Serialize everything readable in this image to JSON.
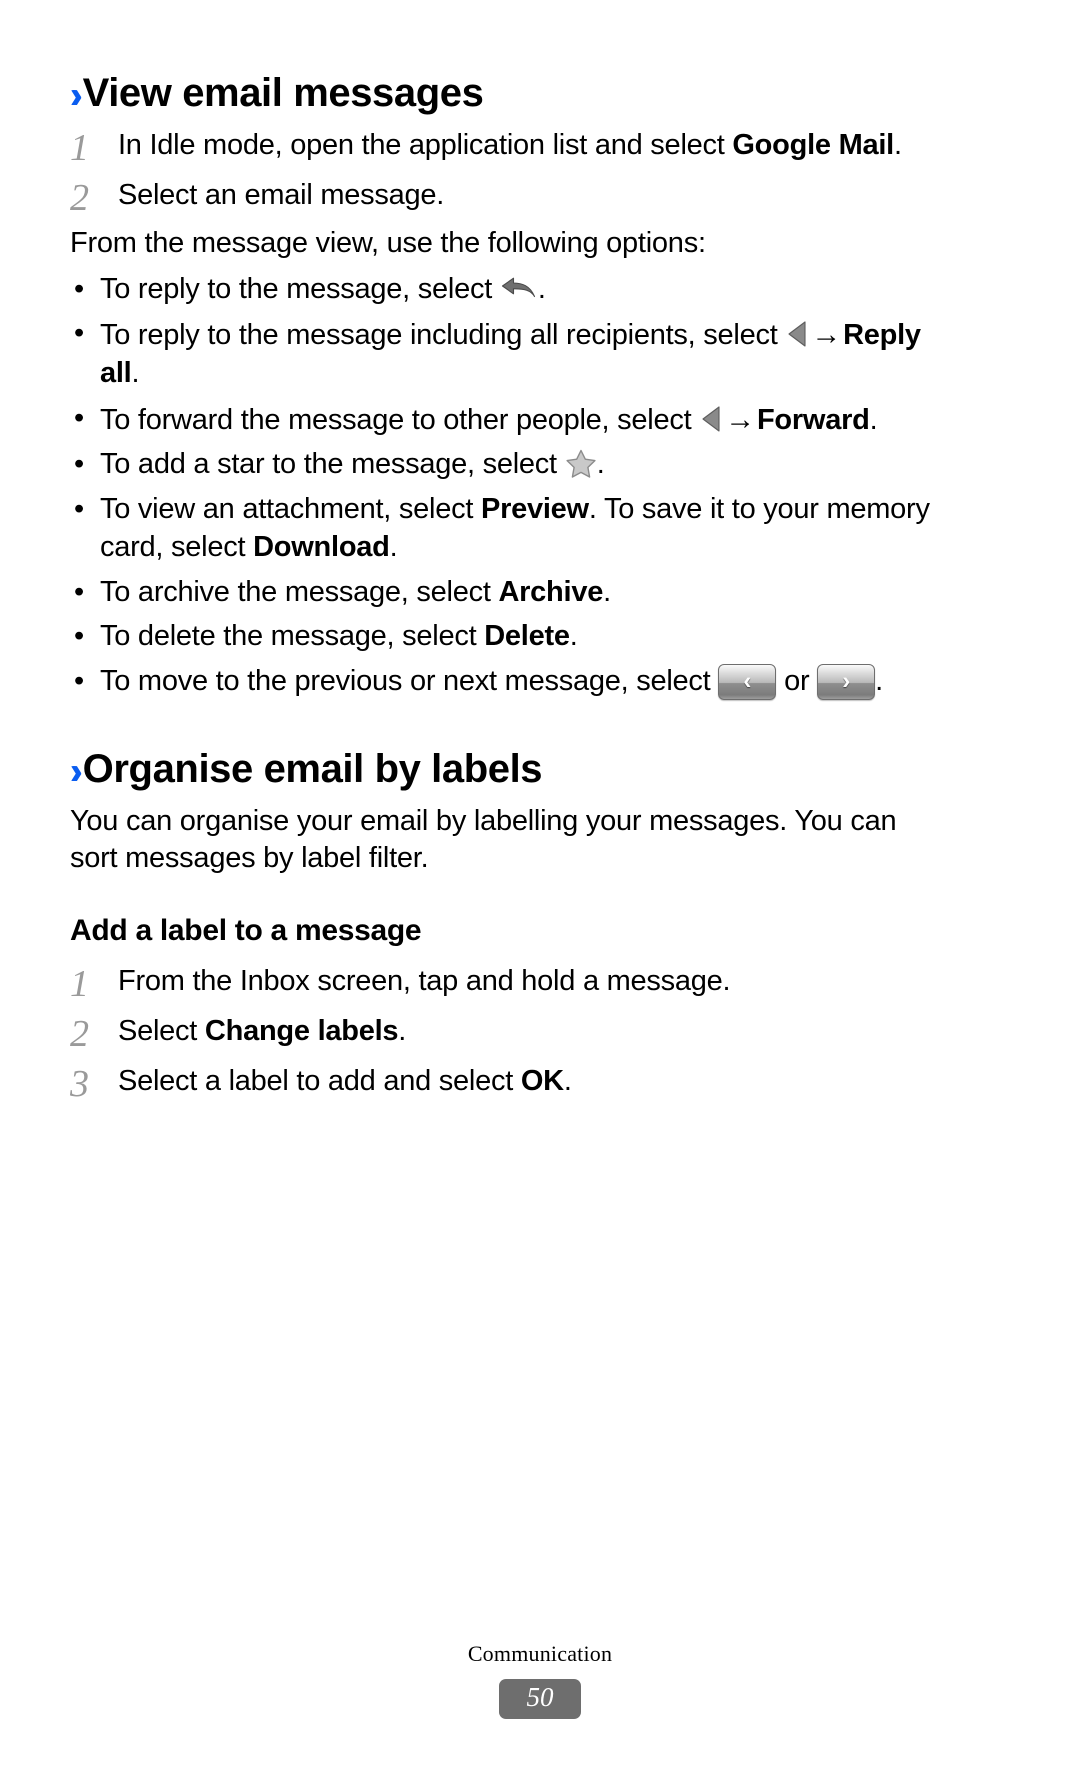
{
  "accent_color": "#0a5df0",
  "section1": {
    "heading": "View email messages",
    "chevron_icon": "double-chevron-right-icon",
    "steps": [
      {
        "num": "1",
        "text_before": "In Idle mode, open the application list and select ",
        "bold": "Google Mail",
        "text_after": "."
      },
      {
        "num": "2",
        "text_before": "Select an email message.",
        "bold": "",
        "text_after": ""
      }
    ],
    "intro": "From the message view, use the following options:",
    "bullet_char": "•",
    "bullets": [
      {
        "id": "reply",
        "lead": "To reply to the message, select ",
        "icon": "reply-arrow-icon",
        "tail": "."
      },
      {
        "id": "reply-all",
        "lead": "To reply to the message including all recipients, select ",
        "icon": "triangle-left-icon",
        "arrow": "→",
        "bold": "Reply all",
        "tail": "."
      },
      {
        "id": "forward",
        "lead": "To forward the message to other people, select ",
        "icon": "triangle-left-icon",
        "arrow": "→",
        "bold": "Forward",
        "tail": "."
      },
      {
        "id": "star",
        "lead": "To add a star to the message, select ",
        "icon": "star-icon",
        "tail": "."
      },
      {
        "id": "attachment",
        "lead": "To view an attachment, select ",
        "bold": "Preview",
        "mid": ". To save it to your memory card, select ",
        "bold2": "Download",
        "tail": "."
      },
      {
        "id": "archive",
        "lead": "To archive the message, select ",
        "bold": "Archive",
        "tail": "."
      },
      {
        "id": "delete",
        "lead": "To delete the message, select ",
        "bold": "Delete",
        "tail": "."
      },
      {
        "id": "prev-next",
        "lead": "To move to the previous or next message, select ",
        "prev_button_glyph": "‹",
        "or_text": " or ",
        "next_button_glyph": "›",
        "tail": "."
      }
    ]
  },
  "section2": {
    "heading": "Organise email by labels",
    "chevron_icon": "double-chevron-right-icon",
    "intro": "You can organise your email by labelling your messages. You can sort messages by label filter.",
    "subheading": "Add a label to a message",
    "steps": [
      {
        "num": "1",
        "text_before": "From the Inbox screen, tap and hold a message.",
        "bold": "",
        "text_after": ""
      },
      {
        "num": "2",
        "text_before": "Select ",
        "bold": "Change labels",
        "text_after": "."
      },
      {
        "num": "3",
        "text_before": "Select a label to add and select ",
        "bold": "OK",
        "text_after": "."
      }
    ]
  },
  "footer": {
    "label": "Communication",
    "page_number": "50"
  }
}
